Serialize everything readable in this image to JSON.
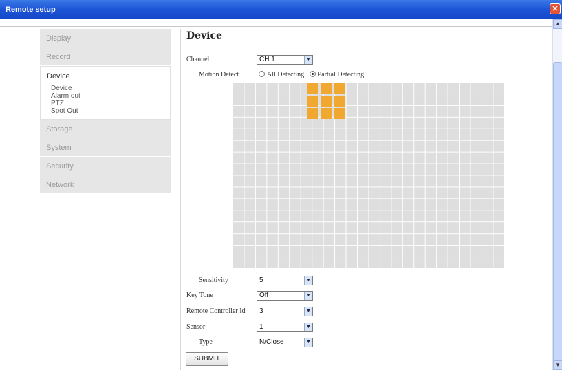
{
  "window": {
    "title": "Remote setup"
  },
  "sidebar": {
    "items": [
      {
        "label": "Display"
      },
      {
        "label": "Record"
      },
      {
        "label": "Device",
        "subitems": [
          "Device",
          "Alarm out",
          "PTZ",
          "Spot Out"
        ]
      },
      {
        "label": "Storage"
      },
      {
        "label": "System"
      },
      {
        "label": "Security"
      },
      {
        "label": "Network"
      }
    ]
  },
  "page": {
    "title": "Device",
    "channel": {
      "label": "Channel",
      "value": "CH 1"
    },
    "motion_detect": {
      "label": "Motion Detect",
      "options": [
        "All Detecting",
        "Partial Detecting"
      ],
      "selected": "Partial Detecting"
    },
    "sensitivity": {
      "label": "Sensitivity",
      "value": "5"
    },
    "key_tone": {
      "label": "Key Tone",
      "value": "Off"
    },
    "remote_controller_id": {
      "label": "Remote Controller Id",
      "value": "3"
    },
    "sensor": {
      "label": "Sensor",
      "value": "1"
    },
    "type": {
      "label": "Type",
      "value": "N/Close"
    },
    "submit_label": "SUBMIT"
  },
  "colors": {
    "titlebar": "#1d55d6",
    "motion_cell": "#f0a830",
    "grid": "#dedede"
  }
}
